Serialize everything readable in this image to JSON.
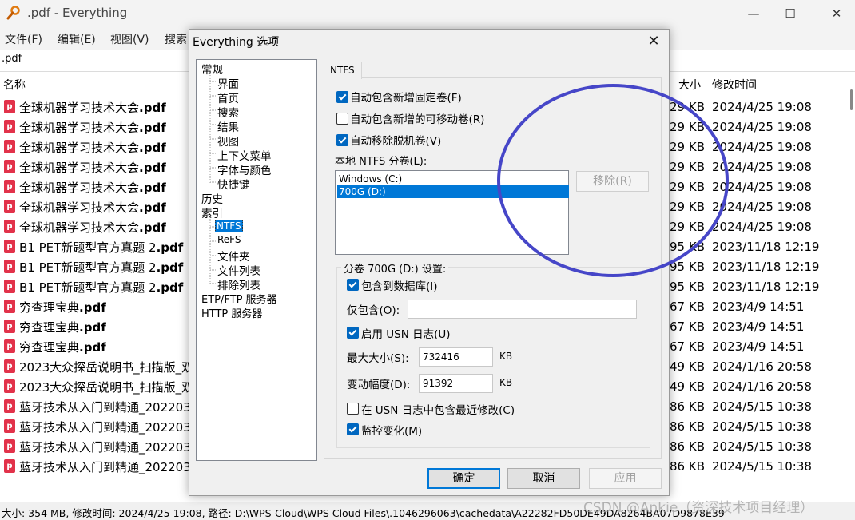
{
  "window": {
    "title": ".pdf - Everything",
    "minimize": "—",
    "maximize": "☐",
    "close": "✕"
  },
  "menu": {
    "file": "文件(F)",
    "edit": "编辑(E)",
    "view": "视图(V)",
    "search": "搜索"
  },
  "search": {
    "value": ".pdf"
  },
  "columns": {
    "name": "名称",
    "size": "大小",
    "modified": "修改时间"
  },
  "files": [
    {
      "name": "全球机器学习技术大会",
      "ext": ".pdf",
      "size": "029 KB",
      "date": "2024/4/25 19:08"
    },
    {
      "name": "全球机器学习技术大会",
      "ext": ".pdf",
      "size": "029 KB",
      "date": "2024/4/25 19:08"
    },
    {
      "name": "全球机器学习技术大会",
      "ext": ".pdf",
      "size": "029 KB",
      "date": "2024/4/25 19:08"
    },
    {
      "name": "全球机器学习技术大会",
      "ext": ".pdf",
      "size": "029 KB",
      "date": "2024/4/25 19:08"
    },
    {
      "name": "全球机器学习技术大会",
      "ext": ".pdf",
      "size": "029 KB",
      "date": "2024/4/25 19:08"
    },
    {
      "name": "全球机器学习技术大会",
      "ext": ".pdf",
      "size": "029 KB",
      "date": "2024/4/25 19:08"
    },
    {
      "name": "全球机器学习技术大会",
      "ext": ".pdf",
      "size": "029 KB",
      "date": "2024/4/25 19:08"
    },
    {
      "name": "B1 PET新题型官方真题 2",
      "ext": ".pdf",
      "size": "095 KB",
      "date": "2023/11/18 12:19"
    },
    {
      "name": "B1 PET新题型官方真题 2",
      "ext": ".pdf",
      "size": "095 KB",
      "date": "2023/11/18 12:19"
    },
    {
      "name": "B1 PET新题型官方真题 2",
      "ext": ".pdf",
      "size": "095 KB",
      "date": "2023/11/18 12:19"
    },
    {
      "name": "穷查理宝典",
      "ext": ".pdf",
      "size": "67 KB",
      "date": "2023/4/9 14:51"
    },
    {
      "name": "穷查理宝典",
      "ext": ".pdf",
      "size": "67 KB",
      "date": "2023/4/9 14:51"
    },
    {
      "name": "穷查理宝典",
      "ext": ".pdf",
      "size": "67 KB",
      "date": "2023/4/9 14:51"
    },
    {
      "name": "2023大众探岳说明书_扫描版_双",
      "ext": "",
      "size": "049 KB",
      "date": "2024/1/16 20:58"
    },
    {
      "name": "2023大众探岳说明书_扫描版_双",
      "ext": "",
      "size": "049 KB",
      "date": "2024/1/16 20:58"
    },
    {
      "name": "蓝牙技术从入门到精通_202203",
      "ext": "",
      "size": "786 KB",
      "date": "2024/5/15 10:38"
    },
    {
      "name": "蓝牙技术从入门到精通_202203",
      "ext": "",
      "size": "786 KB",
      "date": "2024/5/15 10:38"
    },
    {
      "name": "蓝牙技术从入门到精通_202203",
      "ext": "",
      "size": "786 KB",
      "date": "2024/5/15 10:38"
    },
    {
      "name": "蓝牙技术从入门到精通_202203",
      "ext": "",
      "size": "786 KB",
      "date": "2024/5/15 10:38"
    }
  ],
  "status": "大小: 354 MB, 修改时间: 2024/4/25 19:08, 路径: D:\\WPS-Cloud\\WPS Cloud Files\\.1046296063\\cachedata\\A22282FD50DE49DA8264BA07D9878E39",
  "watermark": "CSDN @Ankie（资深技术项目经理）",
  "dialog": {
    "title": "Everything 选项",
    "close": "✕",
    "tree": {
      "general": "常规",
      "ui": "界面",
      "home": "首页",
      "search": "搜索",
      "results": "结果",
      "view": "视图",
      "context_menu": "上下文菜单",
      "fonts_colors": "字体与颜色",
      "shortcuts": "快捷键",
      "history": "历史",
      "index": "索引",
      "ntfs": "NTFS",
      "refs": "ReFS",
      "folders": "文件夹",
      "file_lists": "文件列表",
      "exclude": "排除列表",
      "ftp": "ETP/FTP 服务器",
      "http": "HTTP 服务器"
    },
    "tab": "NTFS",
    "opt_fixed": "自动包含新增固定卷(F)",
    "opt_removable": "自动包含新增的可移动卷(R)",
    "opt_offline": "自动移除脱机卷(V)",
    "local_label": "本地 NTFS 分卷(L):",
    "volumes": [
      "Windows (C:)",
      "700G (D:)"
    ],
    "remove_btn": "移除(R)",
    "group_title": "分卷 700G (D:) 设置:",
    "include_db": "包含到数据库(I)",
    "include_only": "仅包含(O):",
    "include_only_value": "",
    "usn_enable": "启用 USN 日志(U)",
    "max_size_label": "最大大小(S):",
    "max_size": "732416",
    "kb1": "KB",
    "delta_label": "变动幅度(D):",
    "delta": "91392",
    "kb2": "KB",
    "usn_recent": "在 USN 日志中包含最近修改(C)",
    "monitor": "监控变化(M)",
    "ok": "确定",
    "cancel": "取消",
    "apply": "应用"
  }
}
